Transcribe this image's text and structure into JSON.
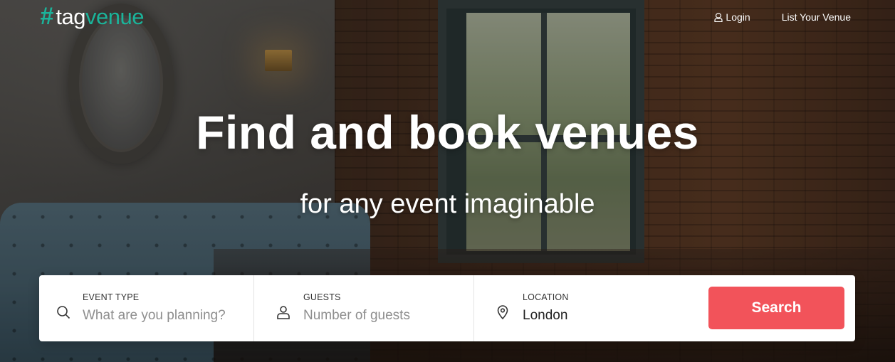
{
  "brand": {
    "hash": "#",
    "tag": "tag",
    "venue": "venue",
    "accent_color": "#1bb39a"
  },
  "nav": {
    "login_label": "Login",
    "list_venue_label": "List Your Venue"
  },
  "hero": {
    "headline": "Find and book venues",
    "subline": "for any event imaginable"
  },
  "search": {
    "event_type": {
      "label": "EVENT TYPE",
      "placeholder": "What are you planning?",
      "value": "",
      "icon": "search-icon"
    },
    "guests": {
      "label": "GUESTS",
      "placeholder": "Number of guests",
      "value": "",
      "icon": "user-icon"
    },
    "location": {
      "label": "LOCATION",
      "placeholder": "",
      "value": "London",
      "icon": "map-pin-icon"
    },
    "button_label": "Search",
    "button_color": "#f2535a"
  }
}
